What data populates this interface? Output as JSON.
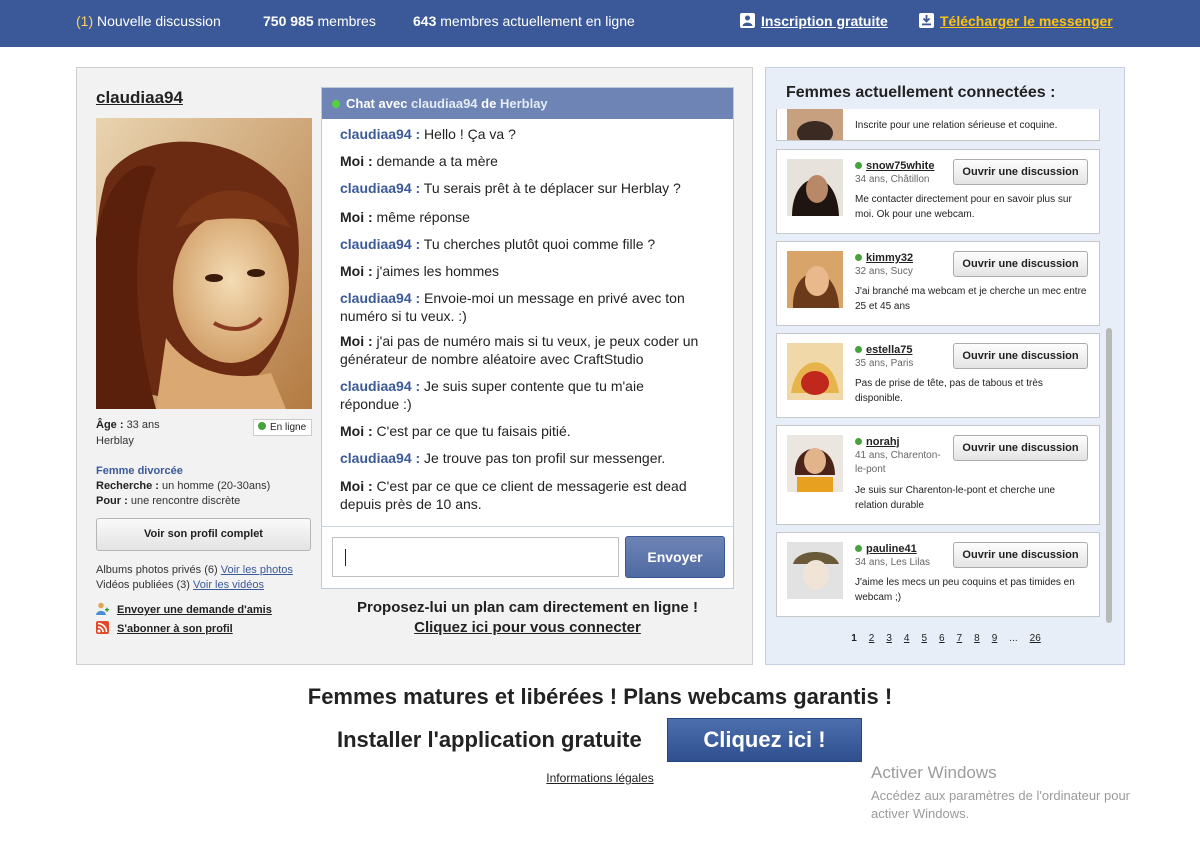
{
  "topbar": {
    "new_count": "(1)",
    "new_label": "Nouvelle discussion",
    "members_count": "750 985",
    "members_label": "membres",
    "online_count": "643",
    "online_label": "membres actuellement en ligne",
    "signup_label": "Inscription gratuite",
    "download_label": "Télécharger le messenger"
  },
  "profile": {
    "username": "claudiaa94",
    "age_label": "Âge :",
    "age_value": "33 ans",
    "city": "Herblay",
    "online_badge": "En ligne",
    "status": "Femme divorcée",
    "seeking_label": "Recherche :",
    "seeking_value": "un homme (20-30ans)",
    "for_label": "Pour :",
    "for_value": "une rencontre discrète",
    "profile_button": "Voir son profil complet",
    "albums_text": "Albums photos privés (6)",
    "albums_link": "Voir les photos",
    "videos_text": "Vidéos publiées (3)",
    "videos_link": "Voir les vidéos",
    "friend_request": "Envoyer une demande d'amis",
    "subscribe": "S'abonner à son profil"
  },
  "chat": {
    "header_prefix": "Chat avec",
    "header_name": "claudiaa94",
    "header_mid": "de",
    "header_city": "Herblay",
    "messages": [
      {
        "who": "claudiaa94 :",
        "text": "Hello ! Ça va ?",
        "her": true
      },
      {
        "who": "Moi :",
        "text": "demande a ta mère",
        "her": false
      },
      {
        "who": "claudiaa94 :",
        "text": "Tu serais prêt à te déplacer sur Herblay ?",
        "her": true
      },
      {
        "who": "Moi :",
        "text": "même réponse",
        "her": false
      },
      {
        "who": "claudiaa94 :",
        "text": "Tu cherches plutôt quoi comme fille ?",
        "her": true
      },
      {
        "who": "Moi :",
        "text": "j'aimes les hommes",
        "her": false
      },
      {
        "who": "claudiaa94 :",
        "text": "Envoie-moi un message en privé avec ton numéro si tu veux. :)",
        "her": true
      },
      {
        "who": "Moi :",
        "text": "j'ai pas de numéro mais si tu veux, je peux coder un générateur de nombre aléatoire avec CraftStudio",
        "her": false
      },
      {
        "who": "claudiaa94 :",
        "text": "Je suis super contente que tu m'aie répondue :)",
        "her": true
      },
      {
        "who": "Moi :",
        "text": "C'est par ce que tu faisais pitié.",
        "her": false
      },
      {
        "who": "claudiaa94 :",
        "text": "Je trouve pas ton profil sur messenger.",
        "her": true
      },
      {
        "who": "Moi :",
        "text": "C'est par ce que ce client de messagerie est dead depuis près de 10 ans.",
        "her": false
      }
    ],
    "input_value": "",
    "send_label": "Envoyer",
    "proposal": "Proposez-lui un plan cam directement en ligne !",
    "proposal_link": "Cliquez ici pour vous connecter"
  },
  "online_women": {
    "title": "Femmes actuellement connectées :",
    "partial_desc": "Inscrite pour une relation sérieuse et coquine.",
    "open_label": "Ouvrir une discussion",
    "list": [
      {
        "name": "snow75white",
        "meta": "34 ans, Châtillon",
        "desc": "Me contacter directement pour en savoir plus sur moi. Ok pour une webcam."
      },
      {
        "name": "kimmy32",
        "meta": "32 ans, Sucy",
        "desc": "J'ai branché ma webcam et je cherche un mec entre 25 et 45 ans"
      },
      {
        "name": "estella75",
        "meta": "35 ans, Paris",
        "desc": "Pas de prise de tête, pas de tabous et très disponible."
      },
      {
        "name": "norahj",
        "meta": "41 ans, Charenton-le-pont",
        "desc": "Je suis sur Charenton-le-pont et cherche une relation durable"
      },
      {
        "name": "pauline41",
        "meta": "34 ans, Les Lilas",
        "desc": "J'aime les mecs un peu coquins et pas timides en webcam ;)"
      }
    ],
    "pages": [
      "1",
      "2",
      "3",
      "4",
      "5",
      "6",
      "7",
      "8",
      "9",
      "...",
      "26"
    ]
  },
  "bottom": {
    "promo_line": "Femmes matures et libérées ! Plans webcams garantis !",
    "install_label": "Installer l'application gratuite",
    "cta_label": "Cliquez ici !",
    "legal": "Informations légales"
  },
  "windows": {
    "title": "Activer Windows",
    "subtitle": "Accédez aux paramètres de l'ordinateur pour activer Windows."
  }
}
